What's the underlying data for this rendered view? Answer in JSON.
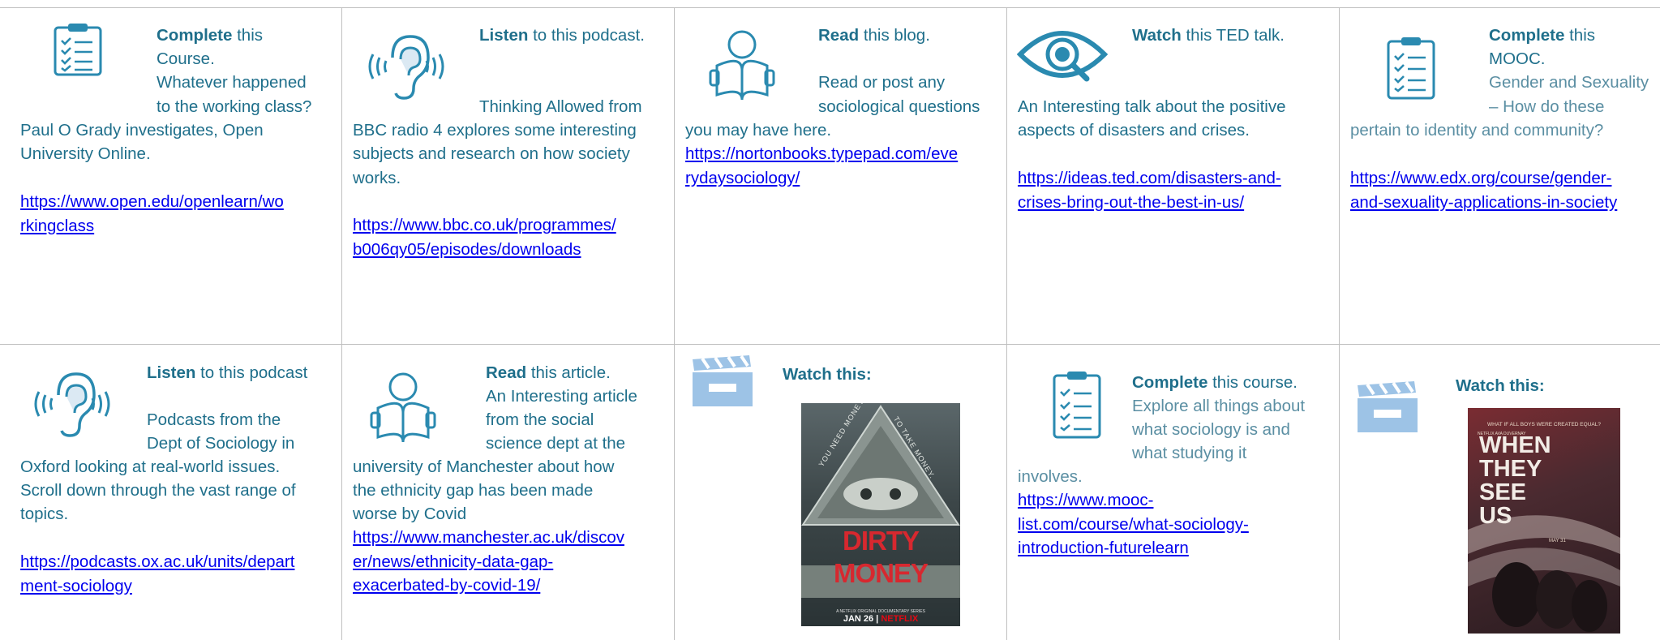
{
  "cells": [
    {
      "action": "Complete",
      "action_rest": " this",
      "lines_beside": [
        "Course.",
        "Whatever happened",
        "to the working class?"
      ],
      "lines_full": [
        "Paul O Grady investigates, Open",
        "University Online."
      ],
      "link": [
        "https://www.open.edu/openlearn/wo",
        "rkingclass"
      ],
      "icon": "checklist-icon"
    },
    {
      "action": "Listen",
      "action_rest": " to this podcast.",
      "lines_beside": [
        "",
        "",
        "Thinking Allowed from"
      ],
      "lines_full": [
        "BBC radio 4 explores some interesting",
        "subjects and research on how society",
        "works."
      ],
      "link": [
        "https://www.bbc.co.uk/programmes/",
        "b006qy05/episodes/downloads"
      ],
      "icon": "ear-icon"
    },
    {
      "action": "Read",
      "action_rest": " this blog.",
      "lines_beside": [
        "",
        "Read or post any",
        "sociological questions"
      ],
      "lines_full": [
        "you may have here."
      ],
      "link": [
        "https://nortonbooks.typepad.com/eve",
        "rydaysociology/"
      ],
      "icon": "reader-icon"
    },
    {
      "action": "Watch",
      "action_rest": " this TED talk.",
      "lines_full": [
        "An Interesting talk about the positive",
        "aspects of disasters and crises."
      ],
      "link": [
        "https://ideas.ted.com/disasters-and-",
        "crises-bring-out-the-best-in-us/"
      ],
      "icon": "eye-icon"
    },
    {
      "action": "Complete",
      "action_rest": " this",
      "lines_beside": [
        "MOOC.",
        "Gender and Sexuality",
        "– How do these"
      ],
      "lines_full": [
        "pertain to identity and community?"
      ],
      "link": [
        "https://www.edx.org/course/gender-",
        "and-sexuality-applications-in-society"
      ],
      "icon": "checklist-icon"
    },
    {
      "action": "Listen",
      "action_rest": " to this podcast",
      "lines_beside": [
        "",
        "Podcasts from the",
        "Dept of Sociology in"
      ],
      "lines_full": [
        "Oxford looking at real-world issues.",
        "Scroll down through the vast range of",
        "topics."
      ],
      "link": [
        "https://podcasts.ox.ac.uk/units/depart",
        "ment-sociology"
      ],
      "icon": "ear-icon"
    },
    {
      "action": "Read",
      "action_rest": " this article.",
      "lines_beside": [
        "An Interesting article",
        "from the social",
        "science dept at the"
      ],
      "lines_full": [
        "university of Manchester about how",
        "the ethnicity gap has been made",
        "worse by Covid"
      ],
      "link": [
        "https://www.manchester.ac.uk/discov",
        "er/news/ethnicity-data-gap-",
        "exacerbated-by-covid-19/"
      ],
      "icon": "reader-icon"
    },
    {
      "heading": "Watch this:",
      "icon": "clapperboard-icon",
      "poster": {
        "top_left": "YOU NEED MONEY.",
        "top_right": "TO TAKE MONEY.",
        "title": "DIRTY MONEY",
        "sub": "A NETFLIX ORIGINAL DOCUMENTARY SERIES",
        "date": "JAN 26",
        "brand": "NETFLIX"
      }
    },
    {
      "action": "Complete",
      "action_rest": " this course.",
      "lines_beside": [
        "Explore all things about",
        "what sociology is and",
        "what studying it"
      ],
      "lines_full": [
        "involves."
      ],
      "link": [
        "https://www.mooc-",
        "list.com/course/what-sociology-",
        "introduction-futurelearn"
      ],
      "icon": "checklist-icon"
    },
    {
      "heading": "Watch this:",
      "icon": "clapperboard-icon",
      "poster": {
        "tag": "WHAT IF ALL BOYS WERE CREATED EQUAL?",
        "credit": "NETFLIX AVA DUVERNAY",
        "title": [
          "WHEN",
          "THEY",
          "SEE",
          "US"
        ],
        "date": "MAY 31"
      }
    }
  ]
}
